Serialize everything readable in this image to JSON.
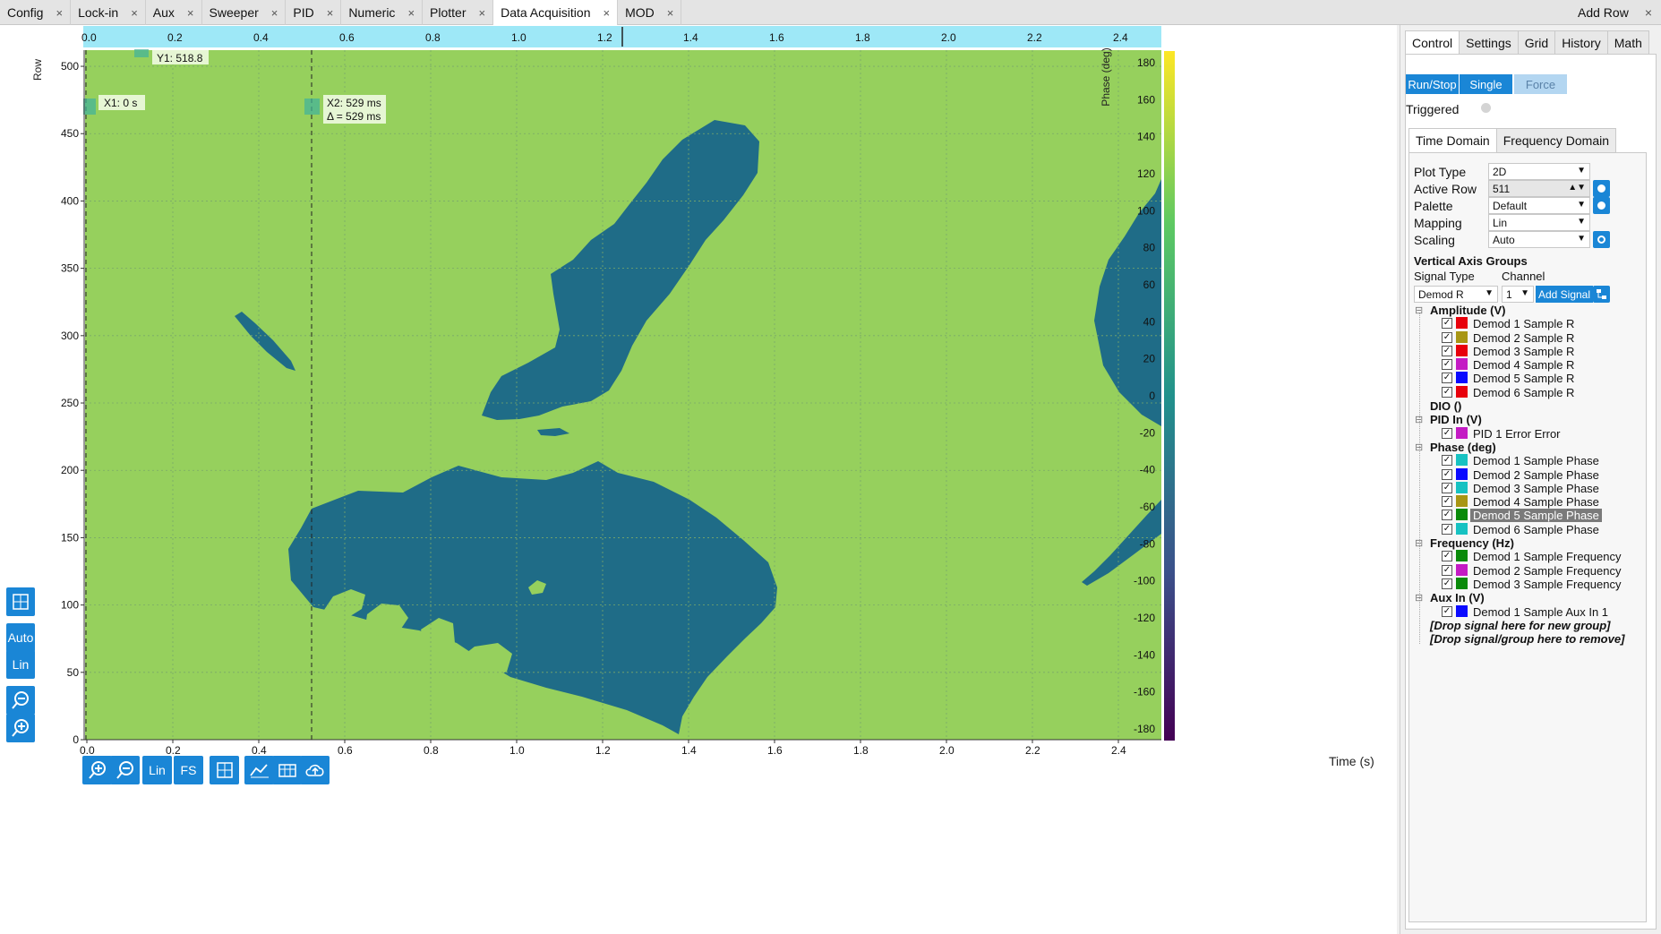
{
  "top_tabs": [
    {
      "label": "Config"
    },
    {
      "label": "Lock-in"
    },
    {
      "label": "Aux"
    },
    {
      "label": "Sweeper"
    },
    {
      "label": "PID"
    },
    {
      "label": "Numeric"
    },
    {
      "label": "Plotter"
    },
    {
      "label": "Data Acquisition",
      "active": true
    },
    {
      "label": "MOD"
    }
  ],
  "tab_close_glyph": "×",
  "add_row_label": "Add Row",
  "plot": {
    "x_ticks_top": [
      "0.0",
      "0.2",
      "0.4",
      "0.6",
      "0.8",
      "1.0",
      "1.2",
      "1.4",
      "1.6",
      "1.8",
      "2.0",
      "2.2",
      "2.4"
    ],
    "x_ticks_bottom": [
      "0.0",
      "0.2",
      "0.4",
      "0.6",
      "0.8",
      "1.0",
      "1.2",
      "1.4",
      "1.6",
      "1.8",
      "2.0",
      "2.2",
      "2.4"
    ],
    "y_ticks": [
      "500",
      "450",
      "400",
      "350",
      "300",
      "250",
      "200",
      "150",
      "100",
      "50",
      "0"
    ],
    "y_axis_label": "Row",
    "colorbar_ticks": [
      "180",
      "160",
      "140",
      "120",
      "100",
      "80",
      "60",
      "40",
      "20",
      "0",
      "-20",
      "-40",
      "-60",
      "-80",
      "-100",
      "-120",
      "-140",
      "-160",
      "-180"
    ],
    "colorbar_label": "Phase (deg)",
    "x_axis_label": "Time (s)",
    "cursor_y1": "Y1: 518.8",
    "cursor_x1": "X1: 0 s",
    "cursor_x2": "X2: 529 ms",
    "cursor_delta": "Δ = 529 ms",
    "x2_position_s": 0.529,
    "background_color": "#96d05d",
    "region_color": "#1f6c87",
    "colormap": [
      "#fde725",
      "#5ec962",
      "#21918c",
      "#3b528b",
      "#440154"
    ]
  },
  "left_tools": {
    "cursor_icon": "cursor-toggle-icon",
    "auto_label": "Auto",
    "lin_label": "Lin",
    "zoom_out_icon": "zoom-out-icon",
    "zoom_in_icon": "zoom-in-icon"
  },
  "bottom_tools": {
    "zoom_in_icon": "zoom-in-icon",
    "zoom_out_icon": "zoom-out-icon",
    "lin_label": "Lin",
    "fs_label": "FS",
    "cursor_icon": "cursor-toggle-icon",
    "math_icon": "math-icon",
    "table_icon": "table-icon",
    "cloud_icon": "cloud-upload-icon"
  },
  "panel": {
    "tabs": [
      {
        "label": "Control",
        "active": true
      },
      {
        "label": "Settings"
      },
      {
        "label": "Grid"
      },
      {
        "label": "History"
      },
      {
        "label": "Math"
      }
    ],
    "run_stop": "Run/Stop",
    "single": "Single",
    "force": "Force",
    "triggered": "Triggered",
    "subtabs": [
      {
        "label": "Time Domain",
        "active": true
      },
      {
        "label": "Frequency Domain"
      }
    ],
    "fields": {
      "plot_type_label": "Plot Type",
      "plot_type_value": "2D",
      "active_row_label": "Active Row",
      "active_row_value": "511",
      "palette_label": "Palette",
      "palette_value": "Default",
      "mapping_label": "Mapping",
      "mapping_value": "Lin",
      "scaling_label": "Scaling",
      "scaling_value": "Auto"
    },
    "vag_title": "Vertical Axis Groups",
    "signal_type_label": "Signal Type",
    "channel_label": "Channel",
    "signal_type_value": "Demod R",
    "channel_value": "1",
    "add_signal": "Add Signal",
    "check_glyph": "✓",
    "collapse_glyph": "⊟",
    "groups": [
      {
        "label": "Amplitude (V)",
        "items": [
          {
            "label": "Demod 1 Sample R",
            "color": "#e8000b"
          },
          {
            "label": "Demod 2 Sample R",
            "color": "#a89614"
          },
          {
            "label": "Demod 3 Sample R",
            "color": "#e8000b"
          },
          {
            "label": "Demod 4 Sample R",
            "color": "#c41bc4"
          },
          {
            "label": "Demod 5 Sample R",
            "color": "#0a0aff"
          },
          {
            "label": "Demod 6 Sample R",
            "color": "#e8000b"
          }
        ]
      },
      {
        "label": "DIO ()",
        "items": []
      },
      {
        "label": "PID In (V)",
        "items": [
          {
            "label": "PID 1 Error Error",
            "color": "#c41bc4"
          }
        ]
      },
      {
        "label": "Phase (deg)",
        "items": [
          {
            "label": "Demod 1 Sample Phase",
            "color": "#17c2c2"
          },
          {
            "label": "Demod 2 Sample Phase",
            "color": "#0a0aff"
          },
          {
            "label": "Demod 3 Sample Phase",
            "color": "#17c2c2"
          },
          {
            "label": "Demod 4 Sample Phase",
            "color": "#a89614"
          },
          {
            "label": "Demod 5 Sample Phase",
            "color": "#0a8a0a",
            "selected": true
          },
          {
            "label": "Demod 6 Sample Phase",
            "color": "#17c2c2"
          }
        ]
      },
      {
        "label": "Frequency (Hz)",
        "items": [
          {
            "label": "Demod 1 Sample Frequency",
            "color": "#0a8a0a"
          },
          {
            "label": "Demod 2 Sample Frequency",
            "color": "#c41bc4"
          },
          {
            "label": "Demod 3 Sample Frequency",
            "color": "#0a8a0a"
          }
        ]
      },
      {
        "label": "Aux In (V)",
        "items": [
          {
            "label": "Demod 1 Sample Aux In 1",
            "color": "#0a0aff"
          }
        ]
      }
    ],
    "drop_new_group": "[Drop signal here for new group]",
    "drop_remove": "[Drop signal/group here to remove]"
  }
}
